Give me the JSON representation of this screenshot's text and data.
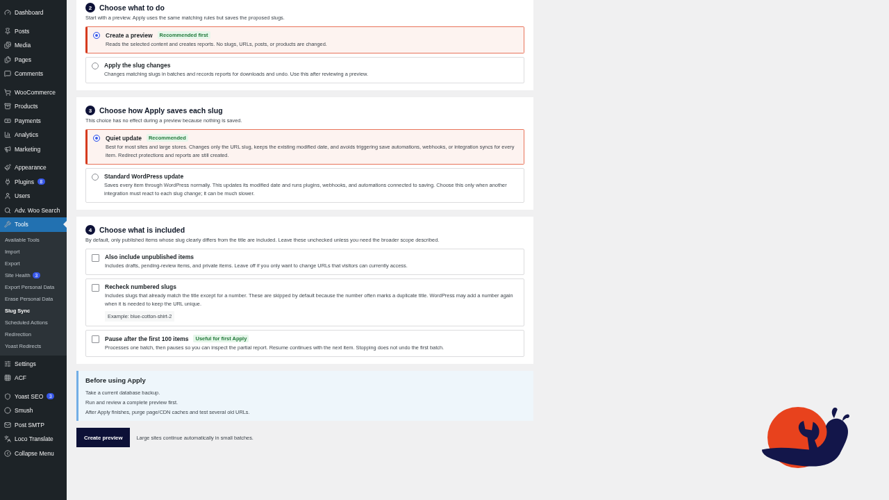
{
  "sidebar": {
    "groups": [
      [
        {
          "label": "Dashboard",
          "selected": false
        }
      ],
      [
        {
          "label": "Posts",
          "selected": false
        },
        {
          "label": "Media",
          "selected": false
        },
        {
          "label": "Pages",
          "selected": false
        },
        {
          "label": "Comments",
          "selected": false
        }
      ],
      [
        {
          "label": "WooCommerce",
          "selected": false
        },
        {
          "label": "Products",
          "selected": false
        },
        {
          "label": "Payments",
          "selected": false
        },
        {
          "label": "Analytics",
          "selected": false
        },
        {
          "label": "Marketing",
          "selected": false
        }
      ],
      [
        {
          "label": "Appearance",
          "selected": false
        },
        {
          "label": "Plugins",
          "badge": "8",
          "selected": false
        },
        {
          "label": "Users",
          "selected": false
        },
        {
          "label": "Adv. Woo Search",
          "selected": false
        },
        {
          "label": "Tools",
          "selected": true,
          "children": [
            {
              "label": "Available Tools",
              "selected": false
            },
            {
              "label": "Import",
              "selected": false
            },
            {
              "label": "Export",
              "selected": false
            },
            {
              "label": "Site Health",
              "badge": "3",
              "selected": false
            },
            {
              "label": "Export Personal Data",
              "selected": false
            },
            {
              "label": "Erase Personal Data",
              "selected": false
            },
            {
              "label": "Slug Sync",
              "selected": true
            },
            {
              "label": "Scheduled Actions",
              "selected": false
            },
            {
              "label": "Redirection",
              "selected": false
            },
            {
              "label": "Yoast Redirects",
              "selected": false
            }
          ]
        },
        {
          "label": "Settings",
          "selected": false
        },
        {
          "label": "ACF",
          "selected": false
        }
      ],
      [
        {
          "label": "Yoast SEO",
          "badge": "3",
          "selected": false
        },
        {
          "label": "Smush",
          "selected": false
        },
        {
          "label": "Post SMTP",
          "selected": false
        },
        {
          "label": "Loco Translate",
          "selected": false
        },
        {
          "label": "Collapse Menu",
          "selected": false
        }
      ]
    ]
  },
  "sections": [
    {
      "number": "2",
      "title": "Choose what to do",
      "description": "Start with a preview. Apply uses the same matching rules but saves the proposed slugs.",
      "options": [
        {
          "kind": "radio",
          "label": "Create a preview",
          "tag": "Recommended first",
          "description": "Reads the selected content and creates reports. No slugs, URLs, posts, or products are changed.",
          "selected": true
        },
        {
          "kind": "radio",
          "label": "Apply the slug changes",
          "description": "Changes matching slugs in batches and records reports for downloads and undo. Use this after reviewing a preview.",
          "selected": false
        }
      ]
    },
    {
      "number": "3",
      "title": "Choose how Apply saves each slug",
      "description": "This choice has no effect during a preview because nothing is saved.",
      "options": [
        {
          "kind": "radio",
          "label": "Quiet update",
          "tag": "Recommended",
          "description": "Best for most sites and large stores. Changes only the URL slug, keeps the existing modified date, and avoids triggering save automations, webhooks, or integration syncs for every item. Redirect protections and reports are still created.",
          "selected": true
        },
        {
          "kind": "radio",
          "label": "Standard WordPress update",
          "description": "Saves every item through WordPress normally. This updates its modified date and runs plugins, webhooks, and automations connected to saving. Choose this only when another integration must react to each slug change; it can be much slower.",
          "selected": false
        }
      ]
    },
    {
      "number": "4",
      "title": "Choose what is included",
      "description": "By default, only published items whose slug clearly differs from the title are included. Leave these unchecked unless you need the broader scope described.",
      "options": [
        {
          "kind": "checkbox",
          "label": "Also include unpublished items",
          "description": "Includes drafts, pending-review items, and private items. Leave off if you only want to change URLs that visitors can currently access.",
          "checked": false
        },
        {
          "kind": "checkbox",
          "label": "Recheck numbered slugs",
          "description": "Includes slugs that already match the title except for a number. These are skipped by default because the number often marks a duplicate title. WordPress may add a number again when it is needed to keep the URL unique.",
          "example": "Example: blue-cotton-shirt-2",
          "checked": false
        },
        {
          "kind": "checkbox",
          "label": "Pause after the first 100 items",
          "tag": "Useful for first Apply",
          "description": "Processes one batch, then pauses so you can inspect the partial report. Resume continues with the next item. Stopping does not undo the first batch.",
          "checked": false
        }
      ]
    }
  ],
  "notice": {
    "title": "Before using Apply",
    "lines": [
      "Take a current database backup.",
      "Run and review a complete preview first.",
      "After Apply finishes, purge page/CDN caches and test several old URLs."
    ]
  },
  "action": {
    "button": "Create preview",
    "note": "Large sites continue automatically in small batches."
  }
}
